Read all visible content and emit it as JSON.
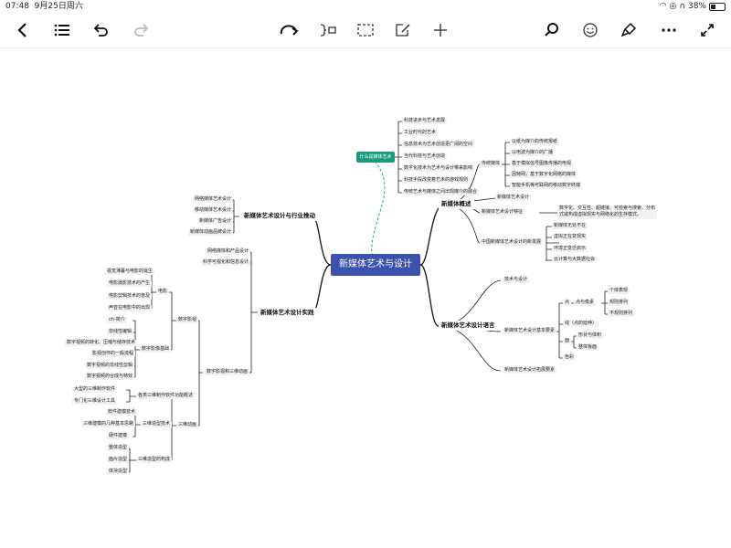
{
  "status": {
    "time": "07:48",
    "date": "9月25日周六",
    "battery": "38%",
    "battery_fraction": 0.38
  },
  "toolbar": {
    "icons": [
      "back-icon",
      "outline-list-icon",
      "undo-icon",
      "redo-icon",
      "relayout-icon",
      "summary-icon",
      "boundary-icon",
      "edit-note-icon",
      "add-icon",
      "search-icon",
      "emoji-icon",
      "format-brush-icon",
      "more-icon",
      "fullscreen-icon"
    ]
  },
  "colors": {
    "root": "#3b53ad",
    "callout": "#1a9b7b",
    "line": "#222222",
    "dashed": "#1a9b7b"
  },
  "map": {
    "root": "新媒体艺术与设计",
    "callout": "什么是媒体艺术",
    "callout_items": [
      "科技进步与艺术发展",
      "工业时代的艺术",
      "信息技术为艺术创造更广阔的空间",
      "当代科技与艺术创造",
      "数字化技术为艺术与设计带来影响",
      "科技手段改变着艺术的游戏规则",
      "传统艺术与媒体之间出现媒介的融合"
    ],
    "b1": {
      "title": "新媒体概述",
      "traditional": "传统媒体",
      "traditional_items": [
        "以纸为媒介的传统报纸",
        "以电波为媒介的广播",
        "基于模拟信号图像传播的电视",
        "因特网，基于数字化网络的媒体",
        "智能手机等可联网的移动数字终端"
      ],
      "art_design": "新媒体艺术设计",
      "features": "新媒体艺术设计特征",
      "features_desc_1": "数字化、交互性、超链接、可检索与搜索、分布",
      "features_desc_2": "式或构成虚拟现实与网络化的生存模式。",
      "china": "中国新媒体艺术设计的新发展",
      "china_items": [
        "新媒体无处不在",
        "虚拟正在变现实",
        "环境正变迁启示",
        "云计算与大数据社会"
      ]
    },
    "b2": {
      "title": "新媒体艺术设计语言",
      "tech": "技术与设计",
      "elements": "新媒体艺术设计基本要素",
      "point": "点",
      "point_sub": "点与像素",
      "point_items": [
        "个体表现",
        "规则排列",
        "不规则排列"
      ],
      "line": "线（点的延伸）",
      "face": "面",
      "face_items": [
        "形状与体积",
        "整体板面"
      ],
      "color": "色彩",
      "expand": "新媒体艺术设计拓展要素"
    },
    "b3": {
      "title": "新媒体艺术设计与行业推动",
      "items": [
        "网络媒体艺术设计",
        "移动媒体艺术设计",
        "新媒体广告设计",
        "新媒体动画品牌设计"
      ]
    },
    "b4": {
      "title": "新媒体艺术设计实践",
      "web_product": "网络媒体和产品设计",
      "visual": "科学可视化和信息设计",
      "digital_film": "数字影视",
      "movie": "电影",
      "movie_items": [
        "视觉薄暮与电影的诞生",
        "电影摄影技术的产生",
        "电影剪辑技术的普及",
        "声音在电影中的出现"
      ],
      "basics": "数字影像基础",
      "basics_items": [
        "ch-简介",
        "非线性编辑",
        "数字视频的转化、压缩与储存技术",
        "影视创作的一般流程",
        "数字视频的非线性剪辑",
        "数字视频的合成与特效"
      ],
      "film3d": "数字影视和三维动画",
      "anim3d": "三维动画",
      "software": "各类三维制作软件功能概述",
      "software_items": [
        "大型的三维制作软件",
        "专门化三维设计工具"
      ],
      "modeling": "三维造型技术",
      "modeling_items": [
        "软件建模技术",
        "三维建模的几种基本思路",
        "硬件建模"
      ],
      "structure": "三维造型的构成",
      "structure_items": [
        "整体造型",
        "面片造型",
        "体块造型"
      ]
    }
  }
}
